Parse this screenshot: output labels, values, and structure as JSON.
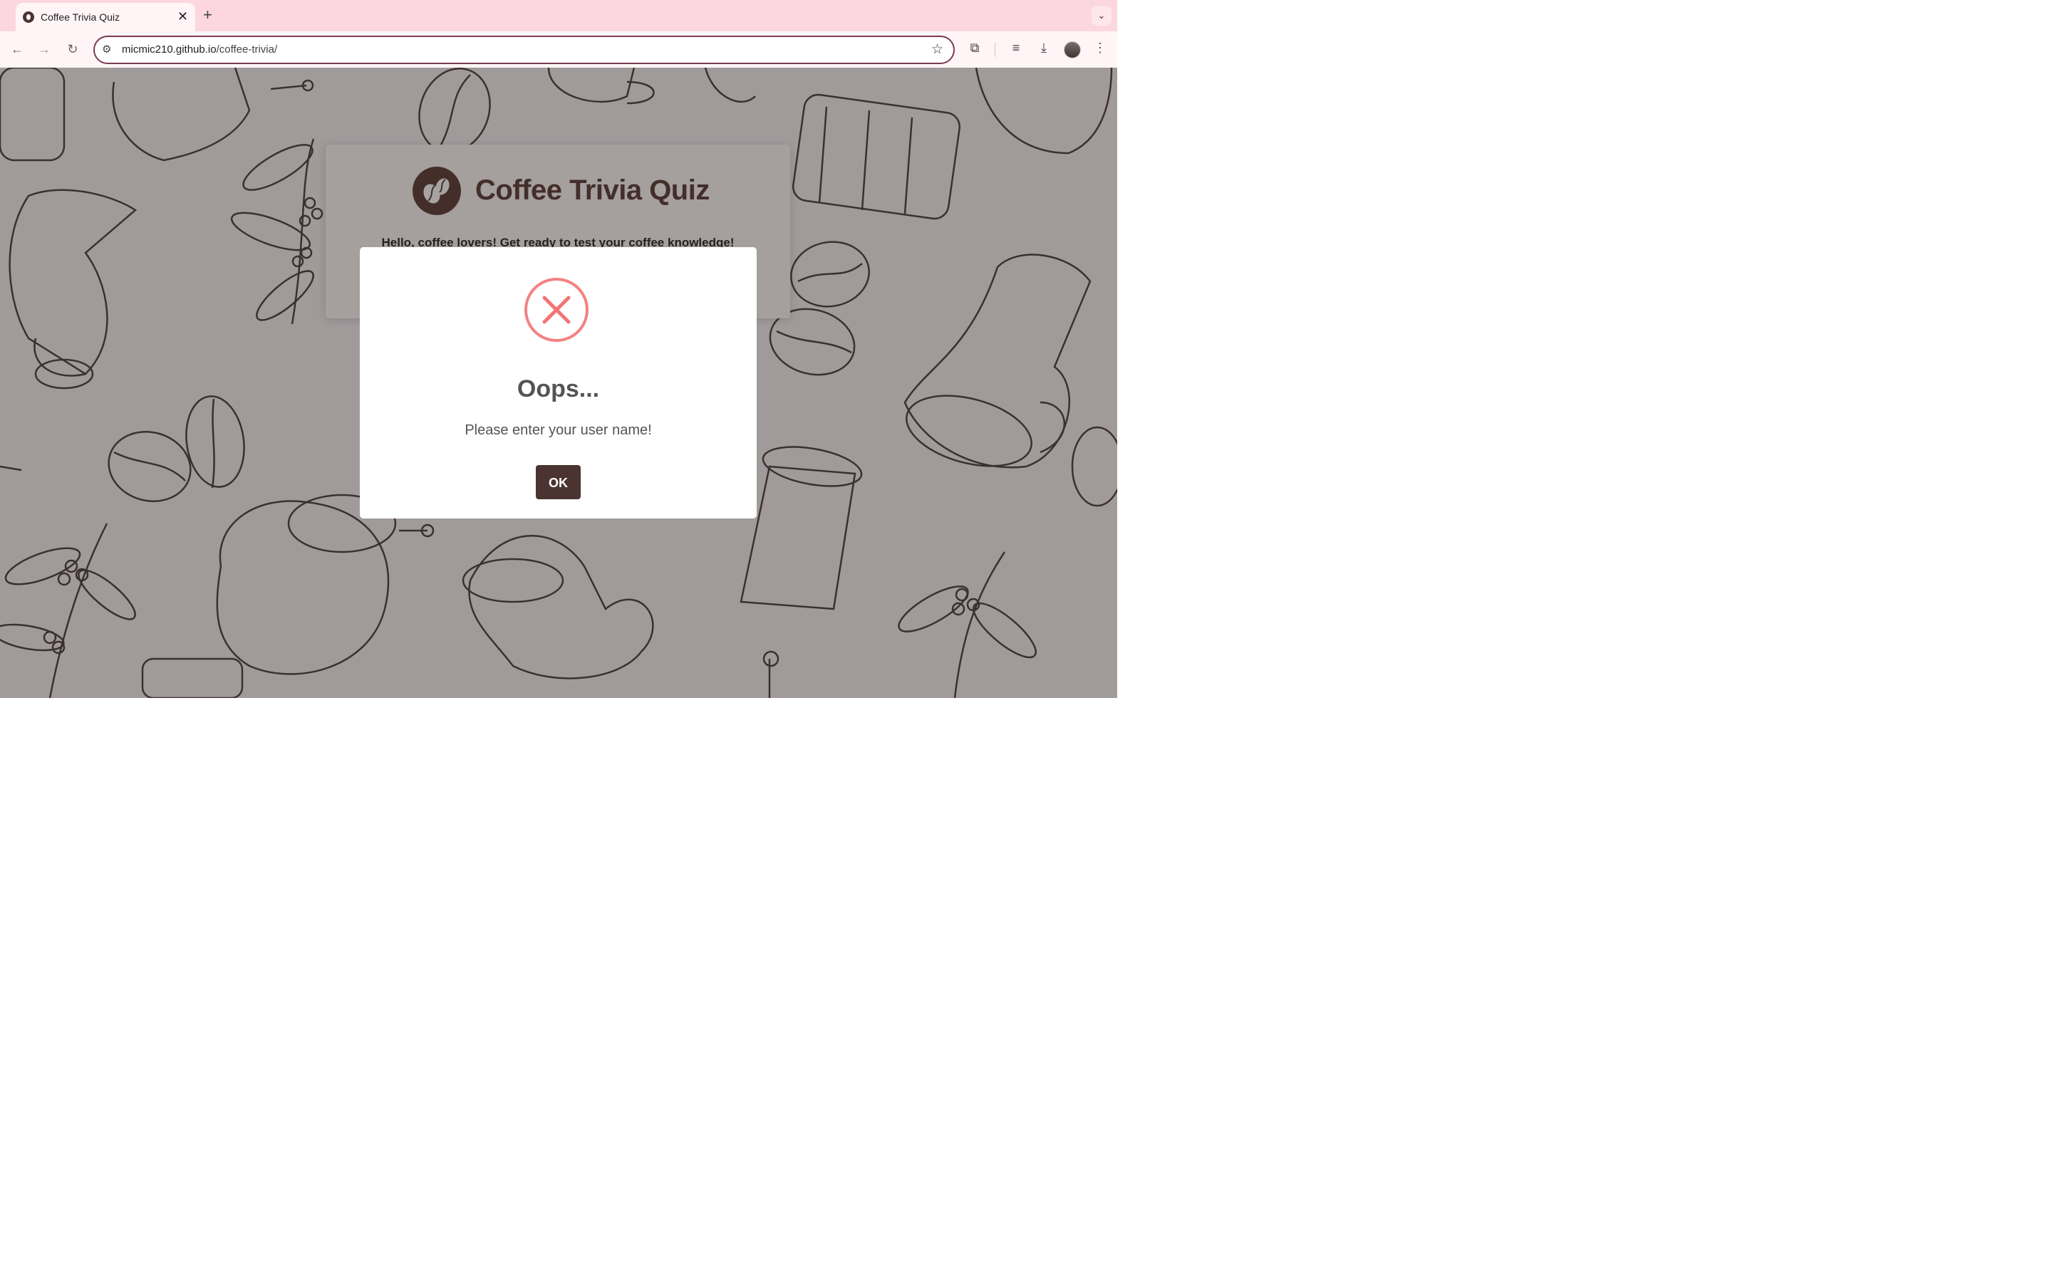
{
  "browser": {
    "tab_title": "Coffee Trivia Quiz",
    "tab_close": "✕",
    "new_tab": "+",
    "tab_search": "⌄",
    "url_domain": "micmic210.github.io",
    "url_path": "/coffee-trivia/"
  },
  "page": {
    "title": "Coffee Trivia Quiz",
    "greeting": "Hello, coffee lovers! Get ready to test your coffee knowledge!"
  },
  "modal": {
    "title": "Oops...",
    "message": "Please enter your user name!",
    "ok_label": "OK",
    "error_color": "#f27474"
  },
  "colors": {
    "brand": "#4a2a24",
    "button": "#4a3330",
    "chrome_frame": "#fcd6e0"
  }
}
